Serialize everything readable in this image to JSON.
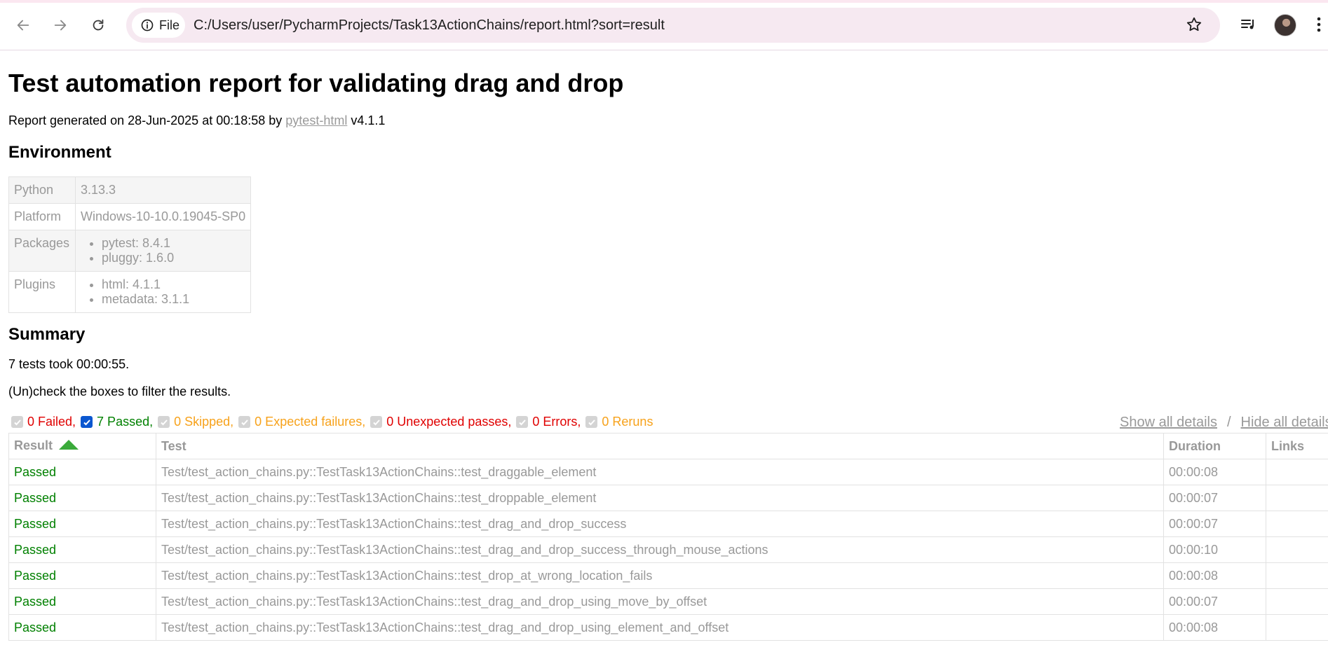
{
  "browser": {
    "scheme_chip": "File",
    "url": "C:/Users/user/PycharmProjects/Task13ActionChains/report.html?sort=result"
  },
  "report": {
    "title": "Test automation report for validating drag and drop",
    "generated_prefix": "Report generated on 28-Jun-2025 at 00:18:58 by ",
    "generated_link": "pytest-html",
    "generated_suffix": " v4.1.1"
  },
  "environment": {
    "heading": "Environment",
    "python_label": "Python",
    "python_value": "3.13.3",
    "platform_label": "Platform",
    "platform_value": "Windows-10-10.0.19045-SP0",
    "packages_label": "Packages",
    "packages": [
      "pytest: 8.4.1",
      "pluggy: 1.6.0"
    ],
    "plugins_label": "Plugins",
    "plugins": [
      "html: 4.1.1",
      "metadata: 3.1.1"
    ]
  },
  "summary": {
    "heading": "Summary",
    "took": "7 tests took 00:00:55.",
    "hint": "(Un)check the boxes to filter the results.",
    "filters": {
      "failed": "0 Failed,",
      "passed": "7 Passed,",
      "skipped": "0 Skipped,",
      "xfailed": "0 Expected failures,",
      "xpassed": "0 Unexpected passes,",
      "errors": "0 Errors,",
      "reruns": "0 Reruns"
    },
    "show_all": "Show all details",
    "separator": "/",
    "hide_all": "Hide all details"
  },
  "results": {
    "headers": {
      "result": "Result",
      "test": "Test",
      "duration": "Duration",
      "links": "Links"
    },
    "rows": [
      {
        "result": "Passed",
        "test": "Test/test_action_chains.py::TestTask13ActionChains::test_draggable_element",
        "duration": "00:00:08"
      },
      {
        "result": "Passed",
        "test": "Test/test_action_chains.py::TestTask13ActionChains::test_droppable_element",
        "duration": "00:00:07"
      },
      {
        "result": "Passed",
        "test": "Test/test_action_chains.py::TestTask13ActionChains::test_drag_and_drop_success",
        "duration": "00:00:07"
      },
      {
        "result": "Passed",
        "test": "Test/test_action_chains.py::TestTask13ActionChains::test_drag_and_drop_success_through_mouse_actions",
        "duration": "00:00:10"
      },
      {
        "result": "Passed",
        "test": "Test/test_action_chains.py::TestTask13ActionChains::test_drop_at_wrong_location_fails",
        "duration": "00:00:08"
      },
      {
        "result": "Passed",
        "test": "Test/test_action_chains.py::TestTask13ActionChains::test_drag_and_drop_using_move_by_offset",
        "duration": "00:00:07"
      },
      {
        "result": "Passed",
        "test": "Test/test_action_chains.py::TestTask13ActionChains::test_drag_and_drop_using_element_and_offset",
        "duration": "00:00:08"
      }
    ]
  },
  "colors": {
    "failed": "#e00000",
    "passed": "#008000",
    "skipped": "#f7a21b",
    "muted": "#999999"
  }
}
